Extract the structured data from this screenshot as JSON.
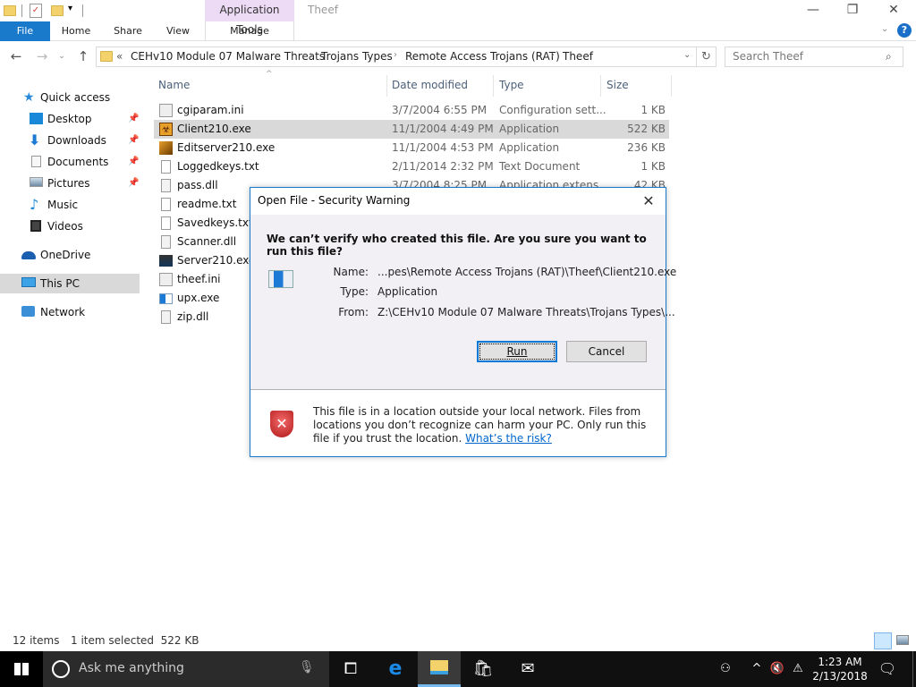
{
  "window": {
    "title": "Theef",
    "context_tab_group": "Application Tools",
    "controls": {
      "minimize": "—",
      "maximize": "❐",
      "close": "✕"
    }
  },
  "ribbon": {
    "tabs": [
      "File",
      "Home",
      "Share",
      "View",
      "Manage"
    ],
    "help_icon": "?"
  },
  "address_bar": {
    "overflow": "«",
    "breadcrumbs": [
      "CEHv10 Module 07 Malware Threats",
      "Trojans Types",
      "Remote Access Trojans (RAT)",
      "Theef"
    ],
    "search_placeholder": "Search Theef"
  },
  "sidebar": {
    "items": [
      {
        "label": "Quick access",
        "icon": "star-icon",
        "pinned": false
      },
      {
        "label": "Desktop",
        "icon": "desktop-icon",
        "pinned": true
      },
      {
        "label": "Downloads",
        "icon": "downloads-icon",
        "pinned": true
      },
      {
        "label": "Documents",
        "icon": "documents-icon",
        "pinned": true
      },
      {
        "label": "Pictures",
        "icon": "pictures-icon",
        "pinned": true
      },
      {
        "label": "Music",
        "icon": "music-icon",
        "pinned": false
      },
      {
        "label": "Videos",
        "icon": "videos-icon",
        "pinned": false
      },
      {
        "label": "OneDrive",
        "icon": "onedrive-icon",
        "pinned": false
      },
      {
        "label": "This PC",
        "icon": "this-pc-icon",
        "pinned": false,
        "selected": true
      },
      {
        "label": "Network",
        "icon": "network-icon",
        "pinned": false
      }
    ]
  },
  "file_list": {
    "columns": [
      "Name",
      "Date modified",
      "Type",
      "Size"
    ],
    "rows": [
      {
        "name": "cgiparam.ini",
        "date": "3/7/2004 6:55 PM",
        "type": "Configuration sett...",
        "size": "1 KB"
      },
      {
        "name": "Client210.exe",
        "date": "11/1/2004 4:49 PM",
        "type": "Application",
        "size": "522 KB",
        "selected": true
      },
      {
        "name": "Editserver210.exe",
        "date": "11/1/2004 4:53 PM",
        "type": "Application",
        "size": "236 KB"
      },
      {
        "name": "Loggedkeys.txt",
        "date": "2/11/2014 2:32 PM",
        "type": "Text Document",
        "size": "1 KB"
      },
      {
        "name": "pass.dll",
        "date": "3/7/2004 8:25 PM",
        "type": "Application extens...",
        "size": "42 KB"
      },
      {
        "name": "readme.txt",
        "date": "",
        "type": "",
        "size": ""
      },
      {
        "name": "Savedkeys.txt",
        "date": "",
        "type": "",
        "size": ""
      },
      {
        "name": "Scanner.dll",
        "date": "",
        "type": "",
        "size": ""
      },
      {
        "name": "Server210.exe",
        "date": "",
        "type": "",
        "size": ""
      },
      {
        "name": "theef.ini",
        "date": "",
        "type": "",
        "size": ""
      },
      {
        "name": "upx.exe",
        "date": "",
        "type": "",
        "size": ""
      },
      {
        "name": "zip.dll",
        "date": "",
        "type": "",
        "size": ""
      }
    ]
  },
  "dialog": {
    "title": "Open File - Security Warning",
    "question": "We can’t verify who created this file. Are you sure you want to run this file?",
    "fields": [
      {
        "key": "Name:",
        "value": "...pes\\Remote Access Trojans (RAT)\\Theef\\Client210.exe"
      },
      {
        "key": "Type:",
        "value": "Application"
      },
      {
        "key": "From:",
        "value": "Z:\\CEHv10 Module 07 Malware Threats\\Trojans Types\\..."
      }
    ],
    "run_label": "Run",
    "cancel_label": "Cancel",
    "warning_text": "This file is in a location outside your local network. Files from locations you don’t recognize can harm your PC. Only run this file if you trust the location.",
    "risk_link": "What’s the risk?"
  },
  "status_bar": {
    "item_count": "12 items",
    "selection": "1 item selected  522 KB"
  },
  "taskbar": {
    "search_placeholder": "Ask me anything",
    "time": "1:23 AM",
    "date": "2/13/2018"
  },
  "colors": {
    "accent": "#1979ca",
    "context_tab": "#eddbf6",
    "selection": "#d9d9d9",
    "link": "#0066cc"
  }
}
